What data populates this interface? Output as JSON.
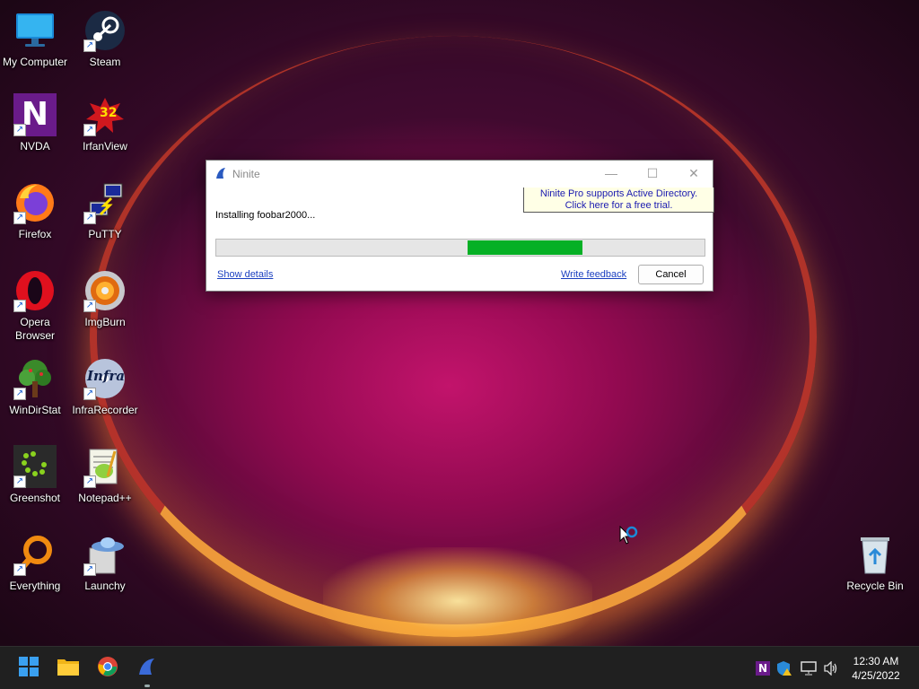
{
  "desktop": {
    "icons": [
      {
        "label": "My Computer",
        "icon": "monitor-icon"
      },
      {
        "label": "Steam",
        "icon": "steam-icon"
      },
      {
        "label": "NVDA",
        "icon": "nvda-icon"
      },
      {
        "label": "IrfanView",
        "icon": "irfanview-icon"
      },
      {
        "label": "Firefox",
        "icon": "firefox-icon"
      },
      {
        "label": "PuTTY",
        "icon": "putty-icon"
      },
      {
        "label": "Opera Browser",
        "icon": "opera-icon"
      },
      {
        "label": "ImgBurn",
        "icon": "imgburn-icon"
      },
      {
        "label": "WinDirStat",
        "icon": "windirstat-icon"
      },
      {
        "label": "InfraRecorder",
        "icon": "infrarecorder-icon"
      },
      {
        "label": "Greenshot",
        "icon": "greenshot-icon"
      },
      {
        "label": "Notepad++",
        "icon": "notepadpp-icon"
      },
      {
        "label": "Everything",
        "icon": "everything-icon"
      },
      {
        "label": "Launchy",
        "icon": "launchy-icon"
      },
      {
        "label": "Recycle Bin",
        "icon": "recycle-bin-icon"
      }
    ],
    "irfanview_badge": "32",
    "nvda_badge": "N",
    "infrarecorder_badge": "Infra"
  },
  "dialog": {
    "title": "Ninite",
    "promo_line1": "Ninite Pro supports Active Directory.",
    "promo_line2": "Click here for a free trial.",
    "status": "Installing foobar2000...",
    "progress_start": 0.515,
    "progress_end": 0.75,
    "show_details": "Show details",
    "write_feedback": "Write feedback",
    "cancel": "Cancel",
    "progress_color": "#06b025"
  },
  "taskbar": {
    "apps": [
      "start-icon",
      "file-explorer-icon",
      "chrome-icon",
      "ninite-icon"
    ],
    "tray_icons": [
      "nvda-tray-icon",
      "security-warning-icon",
      "network-icon",
      "volume-icon"
    ],
    "time": "12:30 AM",
    "date": "4/25/2022"
  }
}
